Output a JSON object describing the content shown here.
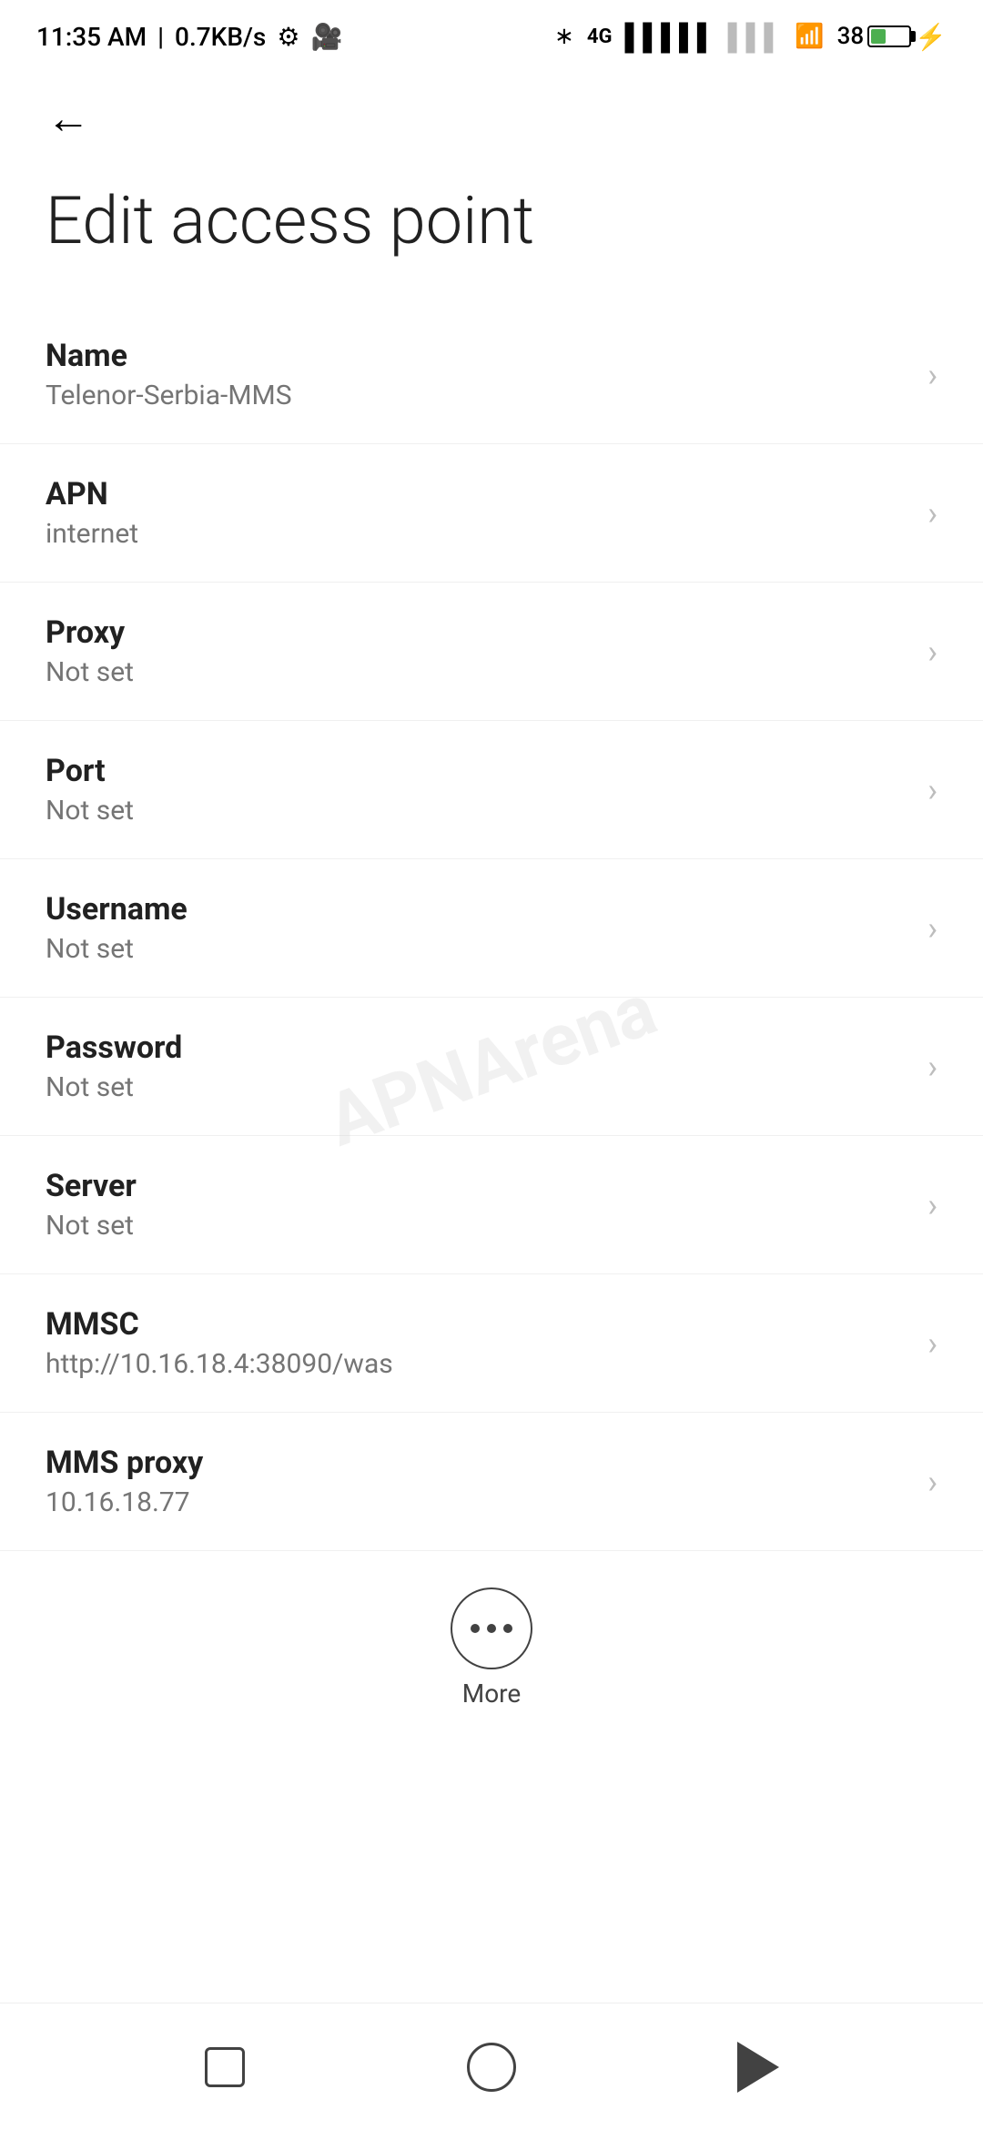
{
  "statusBar": {
    "time": "11:35 AM",
    "speed": "0.7KB/s",
    "batteryPercent": "38"
  },
  "toolbar": {
    "backLabel": "←"
  },
  "page": {
    "title": "Edit access point"
  },
  "settings": {
    "items": [
      {
        "label": "Name",
        "value": "Telenor-Serbia-MMS"
      },
      {
        "label": "APN",
        "value": "internet"
      },
      {
        "label": "Proxy",
        "value": "Not set"
      },
      {
        "label": "Port",
        "value": "Not set"
      },
      {
        "label": "Username",
        "value": "Not set"
      },
      {
        "label": "Password",
        "value": "Not set"
      },
      {
        "label": "Server",
        "value": "Not set"
      },
      {
        "label": "MMSC",
        "value": "http://10.16.18.4:38090/was"
      },
      {
        "label": "MMS proxy",
        "value": "10.16.18.77"
      }
    ]
  },
  "more": {
    "label": "More"
  },
  "watermark": {
    "text": "APNArena"
  }
}
